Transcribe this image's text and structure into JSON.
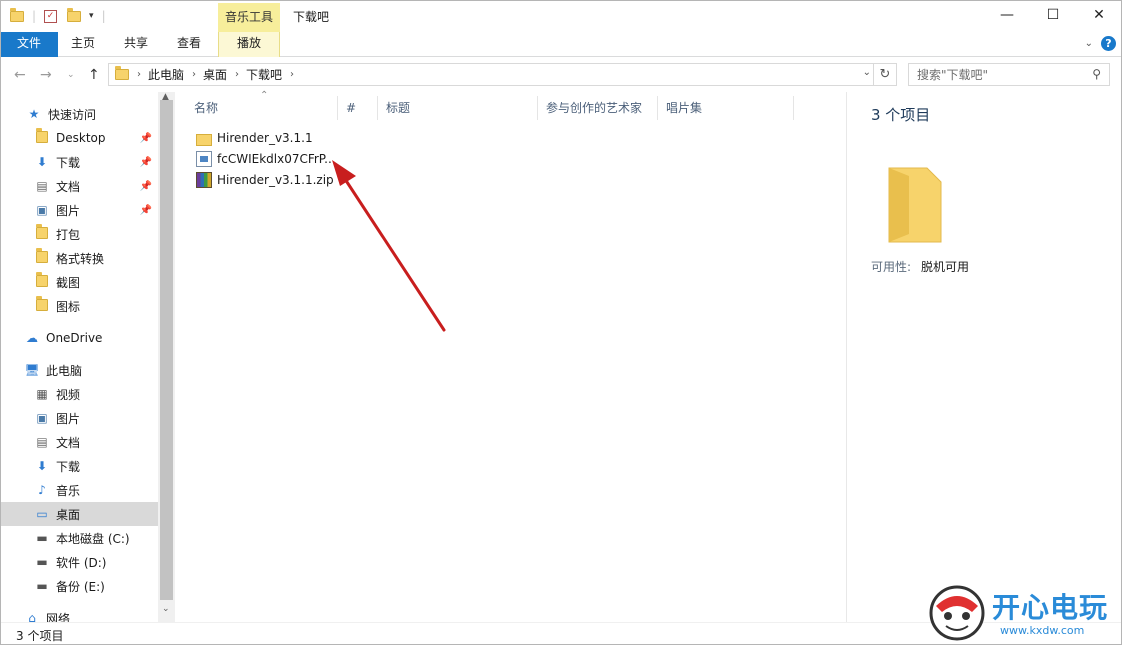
{
  "titlebar": {
    "title": "下载吧",
    "contextual_tab": "音乐工具",
    "minimize": "—",
    "maximize": "☐",
    "close": "✕"
  },
  "ribbon": {
    "tabs": [
      {
        "label": "文件"
      },
      {
        "label": "主页"
      },
      {
        "label": "共享"
      },
      {
        "label": "查看"
      },
      {
        "label": "播放"
      }
    ]
  },
  "address": {
    "crumbs": [
      "此电脑",
      "桌面",
      "下载吧"
    ],
    "search_placeholder": "搜索\"下载吧\""
  },
  "sidebar": {
    "items": [
      {
        "label": "快速访问",
        "icon": "star-icon"
      },
      {
        "label": "Desktop",
        "icon": "folder-icon",
        "pinned": true
      },
      {
        "label": "下载",
        "icon": "download-icon",
        "pinned": true
      },
      {
        "label": "文档",
        "icon": "document-icon",
        "pinned": true
      },
      {
        "label": "图片",
        "icon": "picture-icon",
        "pinned": true
      },
      {
        "label": "打包",
        "icon": "folder-icon"
      },
      {
        "label": "格式转换",
        "icon": "folder-icon"
      },
      {
        "label": "截图",
        "icon": "folder-icon"
      },
      {
        "label": "图标",
        "icon": "folder-icon"
      },
      {
        "label": "OneDrive",
        "icon": "cloud-icon"
      },
      {
        "label": "此电脑",
        "icon": "computer-icon"
      },
      {
        "label": "视频",
        "icon": "video-icon"
      },
      {
        "label": "图片",
        "icon": "picture-icon"
      },
      {
        "label": "文档",
        "icon": "document-icon"
      },
      {
        "label": "下载",
        "icon": "download-icon"
      },
      {
        "label": "音乐",
        "icon": "music-icon"
      },
      {
        "label": "桌面",
        "icon": "desktop-icon",
        "selected": true
      },
      {
        "label": "本地磁盘 (C:)",
        "icon": "drive-icon"
      },
      {
        "label": "软件 (D:)",
        "icon": "drive-icon"
      },
      {
        "label": "备份 (E:)",
        "icon": "drive-icon"
      },
      {
        "label": "网络",
        "icon": "network-icon"
      }
    ]
  },
  "columns": [
    {
      "label": "名称"
    },
    {
      "label": "#"
    },
    {
      "label": "标题"
    },
    {
      "label": "参与创作的艺术家"
    },
    {
      "label": "唱片集"
    }
  ],
  "files": [
    {
      "name": "Hirender_v3.1.1",
      "type": "folder"
    },
    {
      "name": "fcCWIEkdlx07CFrP...",
      "type": "document"
    },
    {
      "name": "Hirender_v3.1.1.zip",
      "type": "zip"
    }
  ],
  "details": {
    "count": "3 个项目",
    "availability_label": "可用性:",
    "availability_value": "脱机可用"
  },
  "status": {
    "text": "3 个项目"
  },
  "watermark": {
    "title": "开心电玩",
    "url": "www.kxdw.com"
  },
  "colors": {
    "accent": "#1979ca",
    "contextual_tab": "#f7ee9b",
    "arrow": "#c81e1e",
    "selected": "#d9d9d9"
  }
}
